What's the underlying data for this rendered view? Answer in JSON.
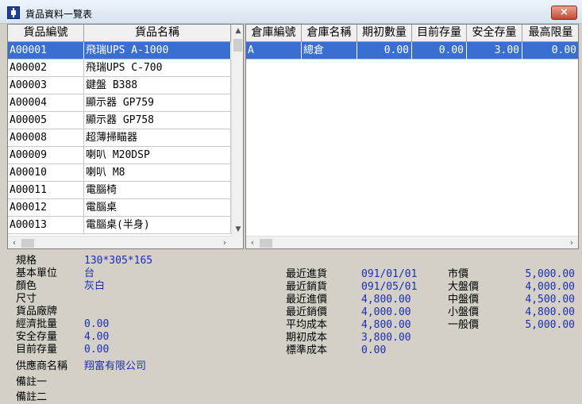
{
  "window": {
    "title": "貨品資料一覽表",
    "close_glyph": "×"
  },
  "products": {
    "columns": [
      "貨品編號",
      "貨品名稱"
    ],
    "rows": [
      [
        "A00001",
        "飛瑞UPS A-1000"
      ],
      [
        "A00002",
        "飛瑞UPS C-700"
      ],
      [
        "A00003",
        "鍵盤 B388"
      ],
      [
        "A00004",
        "顯示器 GP759"
      ],
      [
        "A00005",
        "顯示器 GP758"
      ],
      [
        "A00008",
        "超薄掃瞄器"
      ],
      [
        "A00009",
        "喇叭 M20DSP"
      ],
      [
        "A00010",
        "喇叭 M8"
      ],
      [
        "A00011",
        "電腦椅"
      ],
      [
        "A00012",
        "電腦桌"
      ],
      [
        "A00013",
        "電腦桌(半身)"
      ]
    ],
    "selected_index": 0
  },
  "warehouse": {
    "columns": [
      "倉庫編號",
      "倉庫名稱",
      "期初數量",
      "目前存量",
      "安全存量",
      "最高限量"
    ],
    "rows": [
      [
        "A",
        "總倉",
        "0.00",
        "0.00",
        "3.00",
        "0.00"
      ]
    ],
    "selected_index": 0
  },
  "details": {
    "spec": {
      "label": "規格",
      "value": "130*305*165"
    },
    "unit": {
      "label": "基本單位",
      "value": "台"
    },
    "color": {
      "label": "顏色",
      "value": "灰白"
    },
    "size": {
      "label": "尺寸",
      "value": ""
    },
    "brand": {
      "label": "貨品廠牌",
      "value": ""
    },
    "econ_qty": {
      "label": "經濟批量",
      "value": "0.00"
    },
    "safety_stock": {
      "label": "安全存量",
      "value": "4.00"
    },
    "current_stock": {
      "label": "目前存量",
      "value": "0.00"
    },
    "supplier": {
      "label": "供應商名稱",
      "value": "翔富有限公司"
    },
    "note1": {
      "label": "備註一",
      "value": ""
    },
    "note2": {
      "label": "備註二",
      "value": ""
    },
    "last_purchase": {
      "label": "最近進貨",
      "value": "091/01/01"
    },
    "last_sale": {
      "label": "最近銷貨",
      "value": "091/05/01"
    },
    "last_purchase_price": {
      "label": "最近進價",
      "value": "4,800.00"
    },
    "last_sale_price": {
      "label": "最近銷價",
      "value": "4,000.00"
    },
    "avg_cost": {
      "label": "平均成本",
      "value": "4,800.00"
    },
    "initial_cost": {
      "label": "期初成本",
      "value": "3,800.00"
    },
    "standard_cost": {
      "label": "標準成本",
      "value": "0.00"
    },
    "market_price": {
      "label": "市價",
      "value": "5,000.00"
    },
    "large_wholesale": {
      "label": "大盤價",
      "value": "4,000.00"
    },
    "mid_wholesale": {
      "label": "中盤價",
      "value": "4,500.00"
    },
    "small_wholesale": {
      "label": "小盤價",
      "value": "4,800.00"
    },
    "general_price": {
      "label": "一般價",
      "value": "5,000.00"
    }
  }
}
